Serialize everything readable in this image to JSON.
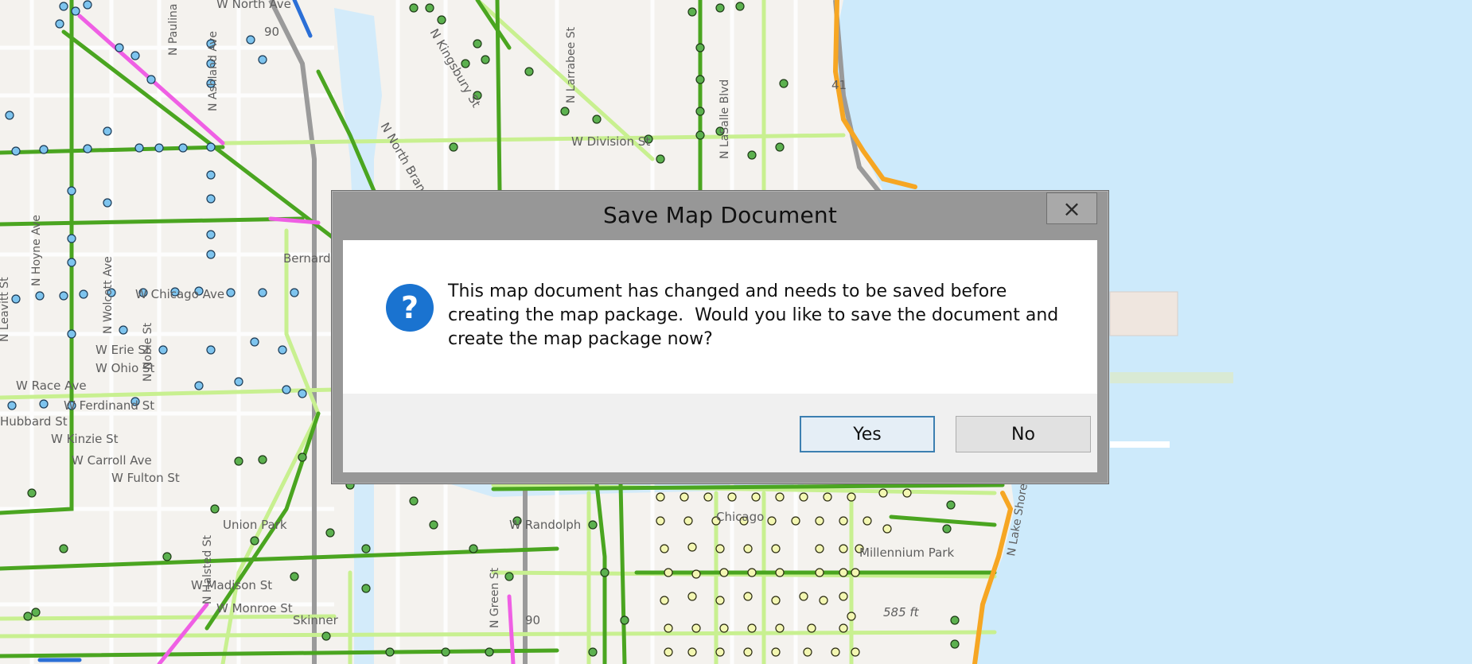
{
  "map": {
    "labels": {
      "w_north_ave": "W North Ave",
      "w_division_st": "W Division St",
      "w_chicago_ave": "W Chicago Ave",
      "w_erie_st": "W Erie St",
      "w_ohio_st": "W Ohio St",
      "w_race_ave": "W Race Ave",
      "w_ferdinand_st": "W Ferdinand St",
      "hubbard_st": "Hubbard St",
      "w_kinzie_st": "W Kinzie St",
      "w_carroll_ave": "W Carroll Ave",
      "w_fulton_st": "W Fulton St",
      "w_randolph": "W Randolph",
      "w_madison_st": "W Madison St",
      "w_monroe_st": "W Monroe St",
      "n_wolcott_ave": "N Wolcott Ave",
      "n_hoyne_ave": "N Hoyne Ave",
      "n_paulina_st": "N Paulina St",
      "n_ashland_ave": "N Ashland Ave",
      "n_noble_st": "N Noble St",
      "n_green_st": "N Green St",
      "n_halsted_st": "N Halsted St",
      "n_lasalle_blvd": "N LaSalle Blvd",
      "n_kingsbury_st": "N Kingsbury St",
      "n_larrabee_st": "N Larrabee St",
      "n_north_branch": "N North Branch",
      "n_leavitt_st": "N Leavitt St",
      "bernard_eckhart": "Bernard Eckhart",
      "union_park": "Union Park",
      "skinner": "Skinner",
      "millennium_park": "Millennium Park",
      "chicago": "Chicago",
      "elevation": "585 ft",
      "hwy_90": "90",
      "hwy_41": "41",
      "lakeshore": "N Lake Shore"
    },
    "colors": {
      "land": "#f4f2ee",
      "water": "#cdeafb",
      "road_green": "#4aa520",
      "road_lime": "#c8f090",
      "road_magenta": "#ef5fe4",
      "road_orange": "#f6a623",
      "stop_blue": "#7ec4ee",
      "stop_green": "#5cb14f",
      "stop_yellow": "#f3f7b2"
    }
  },
  "dialog": {
    "title": "Save Map Document",
    "close_glyph": "×",
    "icon": "question-icon",
    "message": "This map document has changed and needs to be saved before\ncreating the map package.  Would you like to save the document and\ncreate the map package now?",
    "buttons": {
      "yes": "Yes",
      "no": "No"
    },
    "colors": {
      "icon": "#1a73d0",
      "title_bar": "#979797",
      "default_button_border": "#3c7fb1"
    }
  }
}
